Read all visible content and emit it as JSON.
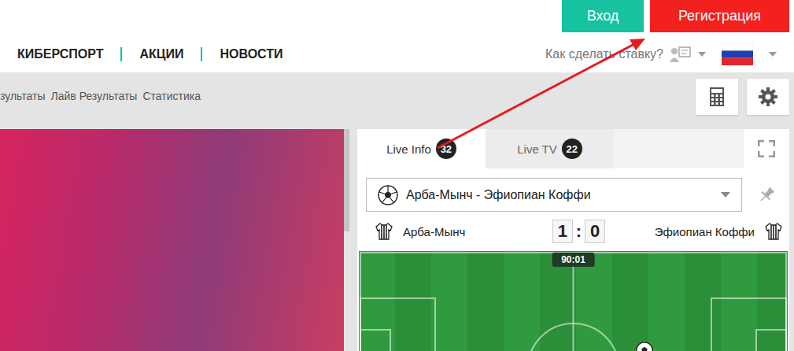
{
  "header": {
    "buttons": [
      {
        "label": "Вход",
        "kind": "login"
      },
      {
        "label": "Регистрация",
        "kind": "register"
      }
    ]
  },
  "nav": {
    "items": [
      "КИБЕРСПОРТ",
      "АКЦИИ",
      "НОВОСТИ"
    ],
    "help": "Как сделать ставку?"
  },
  "subnav": {
    "items": [
      "зультаты",
      "Лайв Результаты",
      "Статистика"
    ]
  },
  "widget": {
    "tabs": [
      {
        "label": "Live Info",
        "count": "32",
        "selected": true
      },
      {
        "label": "Live TV",
        "count": "22",
        "selected": false
      }
    ],
    "match_select": {
      "value": "Арба-Мынч - Эфиопиан Коффи"
    },
    "score": {
      "home": "Арба-Мынч",
      "away": "Эфиопиан Коффи",
      "home_goals": "1",
      "separator": ":",
      "away_goals": "0"
    },
    "time": "90:01"
  }
}
